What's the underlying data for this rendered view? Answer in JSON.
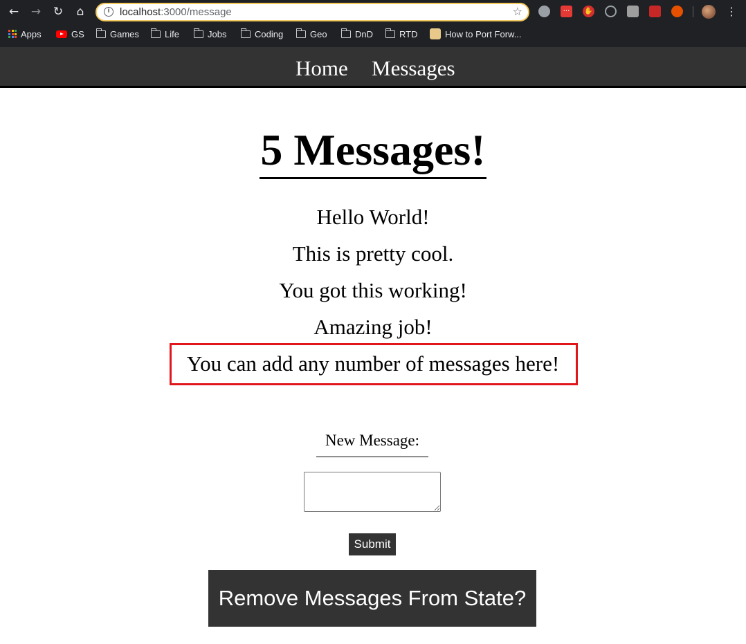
{
  "browser": {
    "url_host": "localhost",
    "url_path": ":3000/message",
    "bookmarks": [
      {
        "label": "Apps",
        "icon": "apps-grid-icon"
      },
      {
        "label": "GS",
        "icon": "youtube-icon"
      },
      {
        "label": "Games",
        "icon": "folder-icon"
      },
      {
        "label": "Life",
        "icon": "folder-icon"
      },
      {
        "label": "Jobs",
        "icon": "folder-icon"
      },
      {
        "label": "Coding",
        "icon": "folder-icon"
      },
      {
        "label": "Geo",
        "icon": "folder-icon"
      },
      {
        "label": "DnD",
        "icon": "folder-icon"
      },
      {
        "label": "RTD",
        "icon": "folder-icon"
      },
      {
        "label": "How to Port Forw...",
        "icon": "page-favicon-icon"
      }
    ],
    "extension_colors": [
      "#9aa0a6",
      "#e53935",
      "#d32f2f",
      "#9aa0a6",
      "#9e9e9e",
      "#c62828",
      "#e65100"
    ]
  },
  "navbar": {
    "home_label": "Home",
    "messages_label": "Messages"
  },
  "main": {
    "title": "5 Messages!",
    "messages": [
      "Hello World!",
      "This is pretty cool.",
      "You got this working!",
      "Amazing job!",
      "You can add any number of messages here!"
    ],
    "highlight_color": "#e0161b",
    "new_message_label": "New Message:",
    "new_message_value": "",
    "submit_label": "Submit",
    "remove_label": "Remove Messages From State?"
  }
}
